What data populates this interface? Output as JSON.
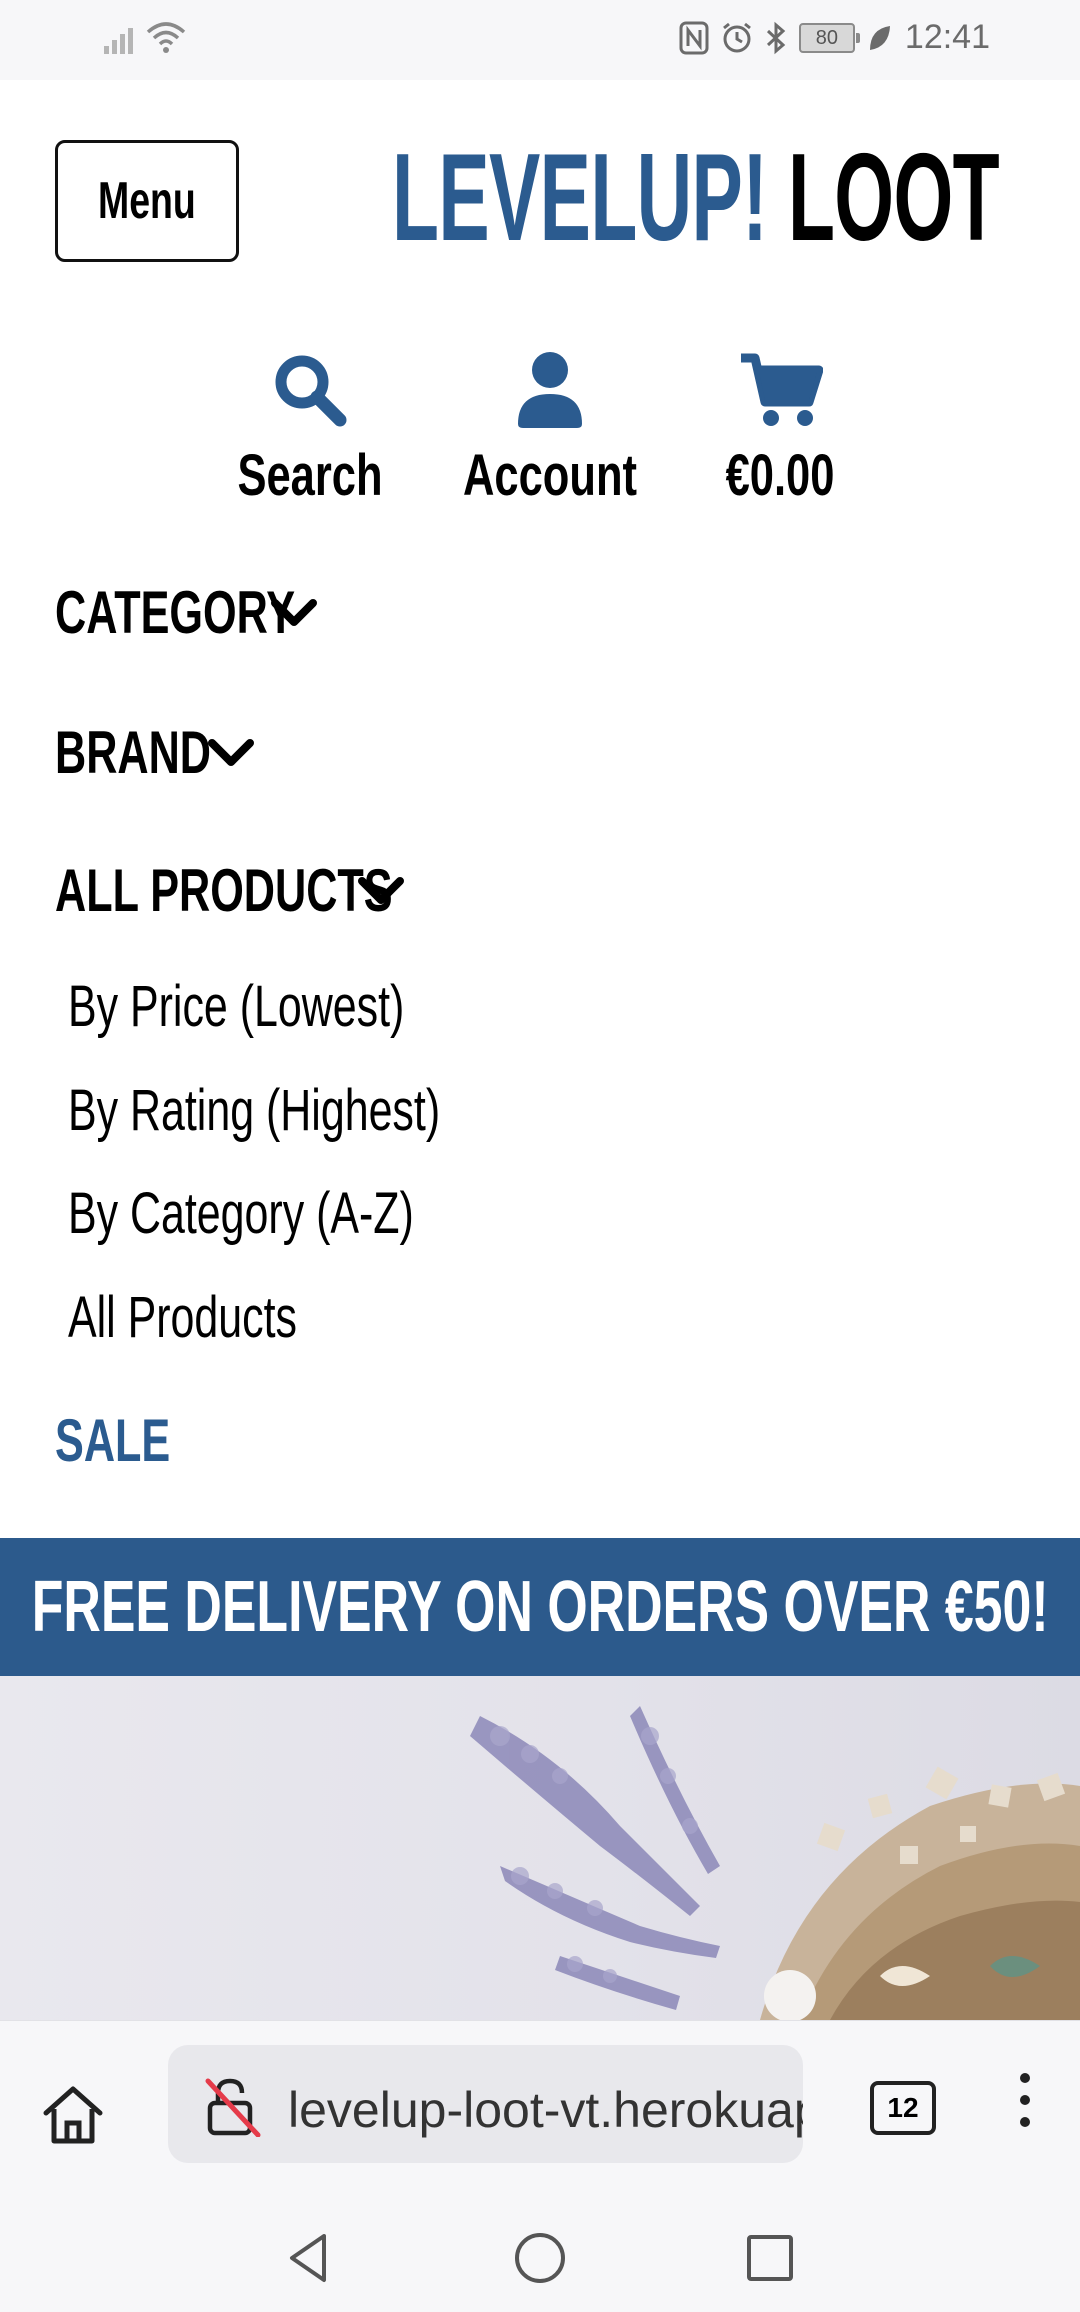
{
  "status_bar": {
    "time": "12:41",
    "battery": "80"
  },
  "header": {
    "menu_label": "Menu",
    "logo_part1": "LEVELUP!",
    "logo_part2": "LOOT",
    "brand_color": "#2b5b8f"
  },
  "tools": {
    "search_label": "Search",
    "account_label": "Account",
    "cart_total": "€0.00"
  },
  "nav": {
    "category": "CATEGORY",
    "brand": "BRAND",
    "all_products": "ALL PRODUCTS",
    "all_products_items": [
      "By Price (Lowest)",
      "By Rating (Highest)",
      "By Category (A-Z)",
      "All Products"
    ],
    "sale": "SALE"
  },
  "banner": {
    "text": "FREE DELIVERY ON ORDERS OVER €50!",
    "color": "#2c5a8c"
  },
  "browser": {
    "url": "levelup-loot-vt.herokuapp.com",
    "tab_count": "12"
  },
  "icons": {
    "search": "search-icon",
    "account": "user-icon",
    "cart": "cart-icon",
    "chevron": "chevron-down-icon",
    "home": "home-icon",
    "lock": "insecure-lock-icon",
    "tabs": "tabs-icon",
    "more": "more-vertical-icon",
    "back": "back-triangle-icon",
    "home_nav": "home-circle-icon",
    "recents": "recents-square-icon"
  }
}
